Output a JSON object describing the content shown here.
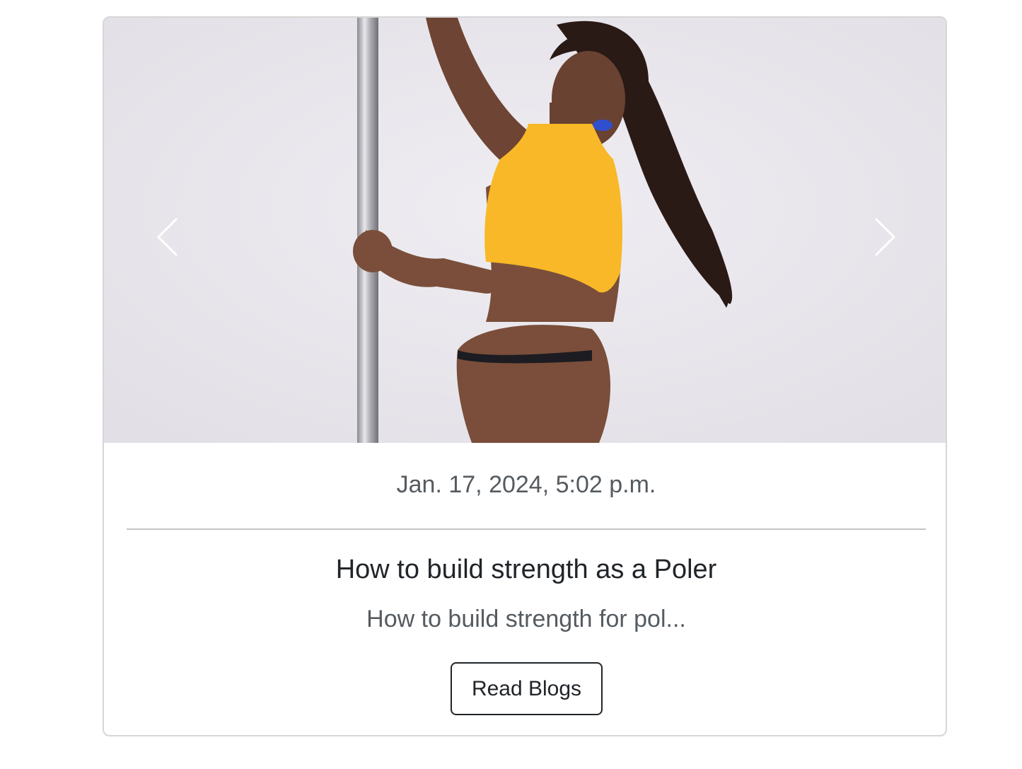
{
  "card": {
    "image": {
      "alt": "Pole dancer in yellow top holding a chrome pole",
      "colors": {
        "background": "#e8e6ec",
        "top": "#f8b828",
        "skin": "#7a4e3a",
        "hair": "#2a1a16",
        "pole": "#c8c8cc"
      }
    },
    "carousel": {
      "prev_icon": "chevron-left-icon",
      "next_icon": "chevron-right-icon"
    },
    "date": "Jan. 17, 2024, 5:02 p.m.",
    "title": "How to build strength as a Poler",
    "excerpt": "How to build strength for pol...",
    "button_label": "Read Blogs"
  }
}
